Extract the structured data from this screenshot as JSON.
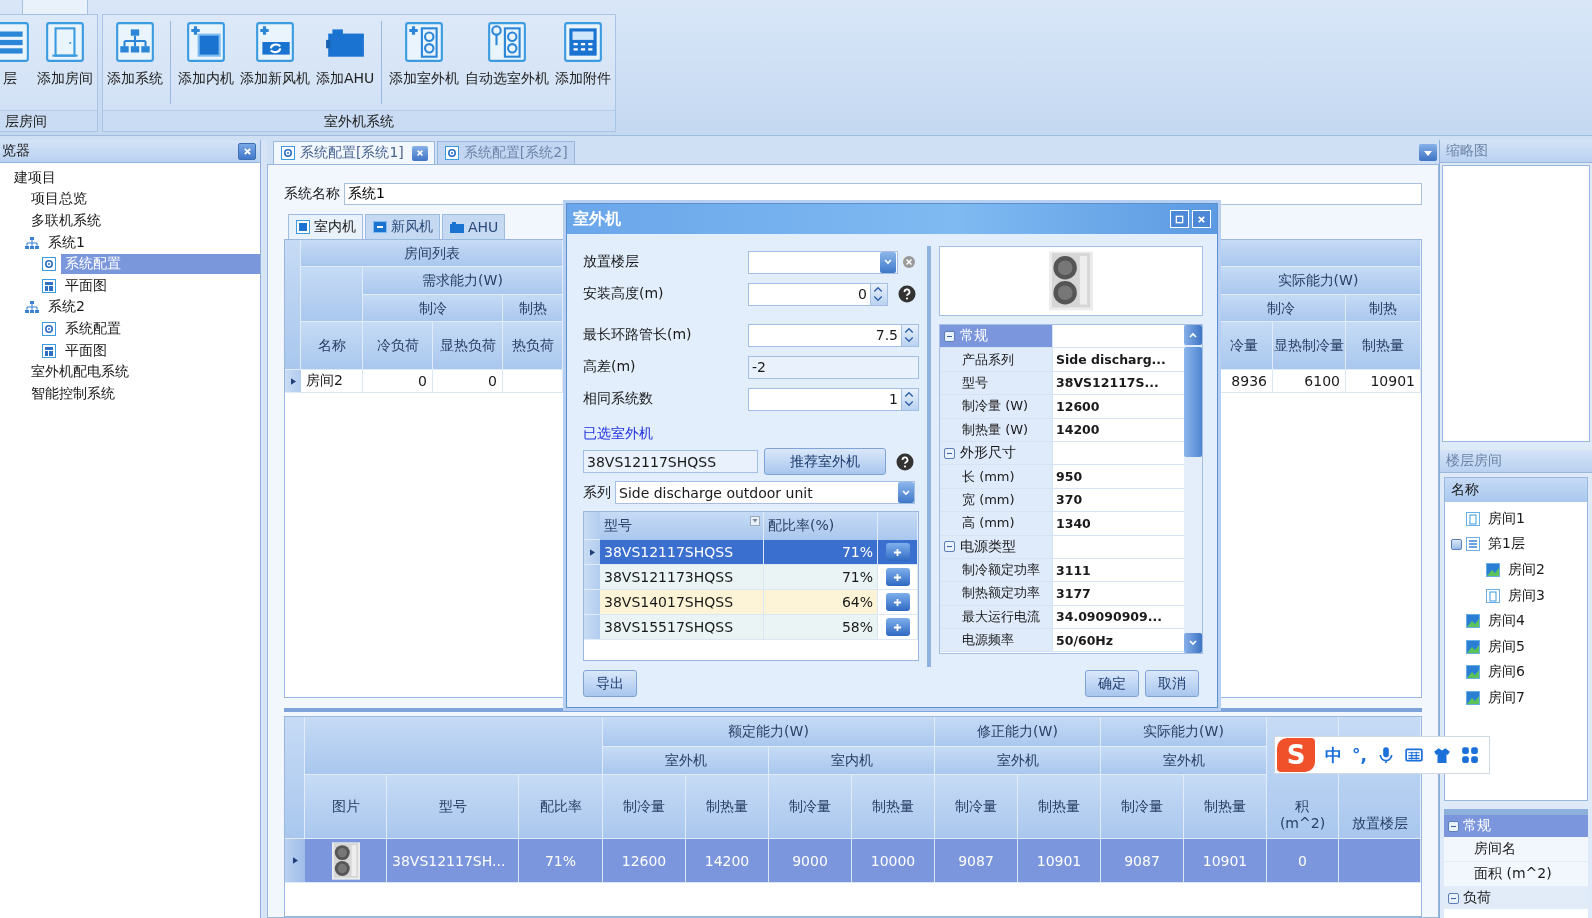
{
  "ribbon": {
    "groups": [
      {
        "label": "层房间",
        "sections": [
          [
            {
              "label": "层",
              "kind": "floor"
            },
            {
              "label": "添加房间",
              "kind": "door"
            }
          ]
        ]
      },
      {
        "label": "室外机系统",
        "sections": [
          [
            {
              "label": "添加系统",
              "kind": "hierarchy"
            }
          ],
          [
            {
              "label": "添加内机",
              "kind": "indoor"
            },
            {
              "label": "添加新风机",
              "kind": "fresh-air"
            },
            {
              "label": "添加AHU",
              "kind": "ahu"
            }
          ],
          [
            {
              "label": "添加室外机",
              "kind": "outdoor-add"
            },
            {
              "label": "自动选室外机",
              "kind": "outdoor-find"
            },
            {
              "label": "添加附件",
              "kind": "controller"
            }
          ]
        ]
      }
    ]
  },
  "explorer": {
    "title": "览器",
    "tree": [
      {
        "label": "建项目",
        "selected": false,
        "children": [
          {
            "label": "项目总览",
            "selected": false
          },
          {
            "label": "多联机系统",
            "selected": false,
            "children": [
              {
                "label": "系统1",
                "kind": "system",
                "selected": false,
                "children": [
                  {
                    "label": "系统配置",
                    "kind": "config",
                    "selected": true
                  },
                  {
                    "label": "平面图",
                    "kind": "plan",
                    "selected": false
                  }
                ]
              },
              {
                "label": "系统2",
                "kind": "system",
                "selected": false,
                "children": [
                  {
                    "label": "系统配置",
                    "kind": "config",
                    "selected": false
                  },
                  {
                    "label": "平面图",
                    "kind": "plan",
                    "selected": false
                  }
                ]
              }
            ]
          },
          {
            "label": "室外机配电系统",
            "selected": false
          },
          {
            "label": "智能控制系统",
            "selected": false
          }
        ]
      }
    ]
  },
  "doc_tabs": [
    {
      "label": "系统配置[系统1]",
      "selected": true,
      "closable": true
    },
    {
      "label": "系统配置[系统2]",
      "selected": false,
      "closable": false
    }
  ],
  "system_name": {
    "label": "系统名称",
    "value": "系统1"
  },
  "unit_tabs": [
    {
      "label": "室内机",
      "kind": "indoor",
      "selected": true
    },
    {
      "label": "新风机",
      "kind": "fresh-air",
      "selected": false
    },
    {
      "label": "AHU",
      "kind": "ahu",
      "selected": false
    }
  ],
  "room_table": {
    "title": "房间列表",
    "demand_group": "需求能力(W)",
    "demand_subgroups": [
      "制冷",
      "制热"
    ],
    "columns": [
      "名称",
      "冷负荷",
      "显热负荷",
      "热负荷"
    ],
    "actual_group": "实际能力(W)",
    "actual_subgroups": [
      "制冷",
      "制热"
    ],
    "actual_columns": [
      "冷量",
      "显热制冷量",
      "制热量"
    ],
    "rows": [
      {
        "selected": false,
        "cells": [
          "房间2",
          "0",
          "0"
        ],
        "actual_cells": [
          "8936",
          "6100",
          "10901"
        ]
      }
    ]
  },
  "dialog": {
    "title": "室外机",
    "fields": [
      {
        "kind": "dropdown",
        "label": "放置楼层"
      },
      {
        "kind": "spin",
        "label": "安装高度(m)",
        "value": "0",
        "help": true
      },
      {
        "kind": "spin",
        "label": "最长环路管长(m)",
        "value": "7.5",
        "help": false
      },
      {
        "kind": "readonly",
        "label": "高差(m)",
        "value": "-2"
      },
      {
        "kind": "spin",
        "label": "相同系统数",
        "value": "1",
        "help": false
      }
    ],
    "selected_link": "已选室外机",
    "selected_value": "38VS12117SHQSS",
    "recommend_button": "推荐室外机",
    "series_label": "系列",
    "series_value": "Side discharge outdoor unit",
    "model_columns": [
      "型号",
      "配比率(%)"
    ],
    "models": [
      {
        "model": "38VS12117SHQSS",
        "ratio": "71%",
        "selected": true,
        "highlighted": false
      },
      {
        "model": "38VS121173HQSS",
        "ratio": "71%",
        "selected": false,
        "highlighted": false
      },
      {
        "model": "38VS14017SHQSS",
        "ratio": "64%",
        "selected": false,
        "highlighted": true
      },
      {
        "model": "38VS15517SHQSS",
        "ratio": "58%",
        "selected": false,
        "highlighted": false
      }
    ],
    "export_button": "导出",
    "ok_button": "确定",
    "cancel_button": "取消",
    "properties": [
      {
        "label": "常规",
        "selected": true,
        "expanded": true,
        "items": [
          {
            "name": "产品系列",
            "value": "Side discharg..."
          },
          {
            "name": "型号",
            "value": "38VS12117S..."
          },
          {
            "name": "制冷量 (W)",
            "value": "12600"
          },
          {
            "name": "制热量 (W)",
            "value": "14200"
          }
        ]
      },
      {
        "label": "外形尺寸",
        "selected": false,
        "expanded": true,
        "items": [
          {
            "name": "长 (mm)",
            "value": "950"
          },
          {
            "name": "宽 (mm)",
            "value": "370"
          },
          {
            "name": "高 (mm)",
            "value": "1340"
          }
        ]
      },
      {
        "label": "电源类型",
        "selected": false,
        "expanded": true,
        "items": [
          {
            "name": "制冷额定功率",
            "value": "3111"
          },
          {
            "name": "制热额定功率",
            "value": "3177"
          },
          {
            "name": "最大运行电流",
            "value": "34.09090909..."
          },
          {
            "name": "电源频率",
            "value": "50/60Hz"
          }
        ]
      }
    ]
  },
  "unit_grid": {
    "lead_columns": [
      "图片",
      "型号",
      "配比率"
    ],
    "groups": [
      {
        "label": "额定能力(W)",
        "subgroups": [
          {
            "label": "室外机",
            "columns": [
              "制冷量",
              "制热量"
            ]
          },
          {
            "label": "室内机",
            "columns": [
              "制冷量",
              "制热量"
            ]
          }
        ]
      },
      {
        "label": "修正能力(W)",
        "subgroups": [
          {
            "label": "室外机",
            "columns": [
              "制冷量",
              "制热量"
            ]
          }
        ]
      },
      {
        "label": "实际能力(W)",
        "subgroups": [
          {
            "label": "室外机",
            "columns": [
              "制冷量",
              "制热量"
            ]
          }
        ]
      }
    ],
    "tail_columns": [
      "积\n(m^2)",
      "放置楼层"
    ],
    "rows": [
      {
        "selected": true,
        "cells": [
          "38VS12117SH...",
          "71%",
          "12600",
          "14200",
          "9000",
          "10000",
          "9087",
          "10901",
          "9087",
          "10901",
          "0"
        ]
      }
    ]
  },
  "thumbnail": {
    "title": "缩略图"
  },
  "floor_rooms": {
    "title": "楼层房间",
    "column": "名称",
    "tree": [
      {
        "label": "房间1",
        "kind": "door",
        "selected": false
      },
      {
        "label": "第1层",
        "kind": "floor",
        "selected": false,
        "children": [
          {
            "label": "房间2",
            "kind": "room",
            "selected": false
          },
          {
            "label": "房间3",
            "kind": "door",
            "selected": false
          }
        ]
      },
      {
        "label": "房间4",
        "kind": "room",
        "selected": false
      },
      {
        "label": "房间5",
        "kind": "room",
        "selected": false
      },
      {
        "label": "房间6",
        "kind": "room",
        "selected": false
      },
      {
        "label": "房间7",
        "kind": "room",
        "selected": false
      }
    ]
  },
  "room_properties": [
    {
      "label": "常规",
      "selected": true,
      "items": [
        "房间名",
        "面积 (m^2)"
      ]
    },
    {
      "label": "负荷",
      "selected": false
    }
  ],
  "ime": {
    "logo": "S",
    "mode": "中",
    "punctuation": "°,"
  }
}
